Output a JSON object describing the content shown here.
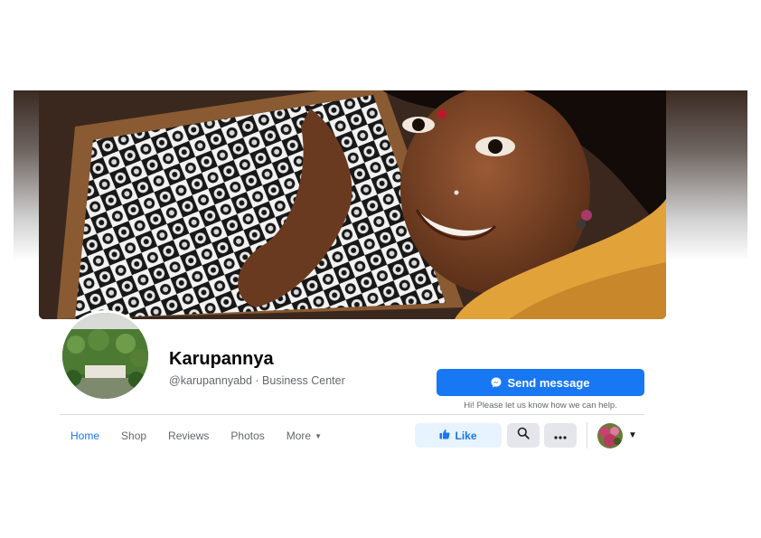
{
  "page": {
    "name": "Karupannya",
    "handle": "@karupannyabd",
    "separator": " · ",
    "category": "Business Center"
  },
  "actions": {
    "send_message": "Send message",
    "hint": "Hi! Please let us know how we can help.",
    "like": "Like"
  },
  "tabs": [
    {
      "label": "Home",
      "active": true
    },
    {
      "label": "Shop"
    },
    {
      "label": "Reviews"
    },
    {
      "label": "Photos"
    },
    {
      "label": "More"
    }
  ],
  "icons": {
    "send": "messenger-icon",
    "like": "thumbs-up-icon",
    "search": "search-icon",
    "more": "ellipsis-icon",
    "dropdown": "chevron-down-icon"
  },
  "colors": {
    "accent": "#1877f2",
    "like_bg": "#e7f3ff",
    "secondary_btn": "#e4e6eb",
    "text_secondary": "#65676b"
  }
}
